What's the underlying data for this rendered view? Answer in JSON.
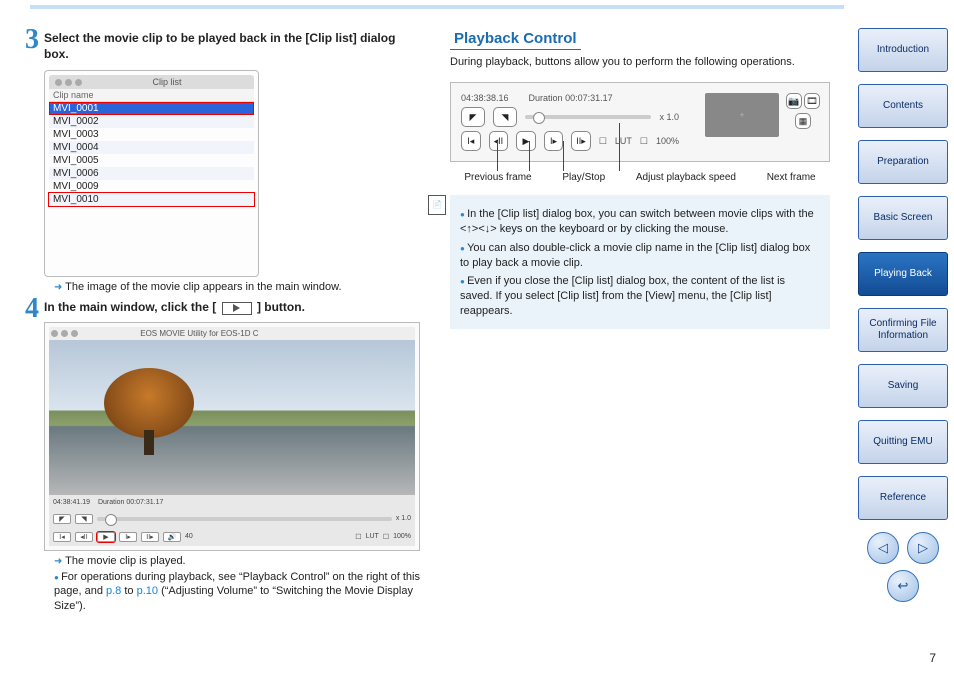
{
  "page_number": "7",
  "left": {
    "step3": {
      "num": "3",
      "title": "Select the movie clip to be played back in the [Clip list] dialog box.",
      "cliplist_title": "Clip list",
      "header": "Clip name",
      "rows": [
        "MVI_0001",
        "MVI_0002",
        "MVI_0003",
        "MVI_0004",
        "MVI_0005",
        "MVI_0006",
        "MVI_0009",
        "MVI_0010"
      ],
      "note": "The image of the movie clip appears in the main window."
    },
    "step4": {
      "num": "4",
      "title_pre": "In the main window, click the [",
      "title_post": "] button.",
      "player_title": "EOS MOVIE Utility for EOS-1D C",
      "timecode": "04:38:41.19",
      "duration": "Duration 00:07:31.17",
      "speed": "x 1.0",
      "lut": "LUT",
      "pct": "100%",
      "vol": "40",
      "note1": "The movie clip is played.",
      "note2a": "For operations during playback, see “Playback Control” on the right of this page, and ",
      "link1": "p.8",
      "mid": " to ",
      "link2": "p.10",
      "note2b": " (“Adjusting Volume” to “Switching the Movie Display Size”)."
    }
  },
  "right": {
    "heading": "Playback Control",
    "sub": "During playback, buttons allow you to perform the following operations.",
    "timecode": "04:38:38.16",
    "duration": "Duration 00:07:31.17",
    "speed": "x 1.0",
    "lut": "LUT",
    "pct": "100%",
    "labels": {
      "prev": "Previous frame",
      "play": "Play/Stop",
      "speed": "Adjust playback speed",
      "next": "Next frame"
    },
    "notes": [
      "In the [Clip list] dialog box, you can switch between movie clips with the <↑><↓> keys on the keyboard or by clicking the mouse.",
      "You can also double-click a movie clip name in the [Clip list] dialog box to play back a movie clip.",
      "Even if you close the [Clip list] dialog box, the content of the list is saved. If you select [Clip list] from the [View] menu, the [Clip list] reappears."
    ]
  },
  "nav": {
    "items": [
      "Introduction",
      "Contents",
      "Preparation",
      "Basic Screen",
      "Playing Back",
      "Confirming File Information",
      "Saving",
      "Quitting EMU",
      "Reference"
    ],
    "active_index": 4
  }
}
